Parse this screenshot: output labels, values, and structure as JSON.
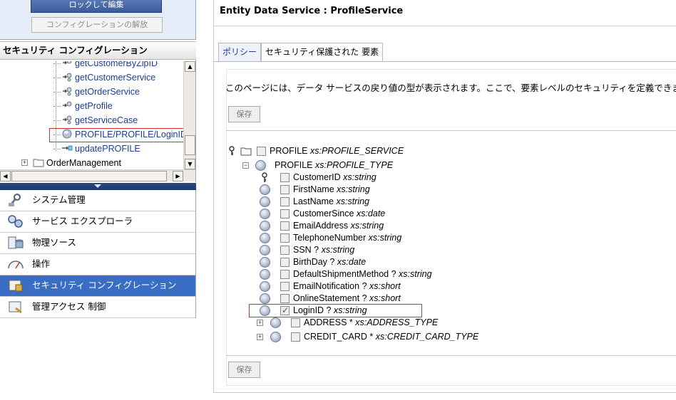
{
  "lock_panel": {
    "lock_edit": "ロックして編集",
    "release_config": "コンフィグレーションの解放"
  },
  "security_panel": {
    "title": "セキュリティ コンフィグレーション",
    "tree": [
      {
        "label": "getCustomerByZipID",
        "icon": "operation-icon"
      },
      {
        "label": "getCustomerService",
        "icon": "operation-icon"
      },
      {
        "label": "getOrderService",
        "icon": "operation-icon"
      },
      {
        "label": "getProfile",
        "icon": "operation-icon"
      },
      {
        "label": "getServiceCase",
        "icon": "operation-icon"
      },
      {
        "label": "PROFILE/PROFILE/LoginID",
        "icon": "element-icon",
        "highlighted": true
      },
      {
        "label": "updatePROFILE",
        "icon": "update-icon"
      },
      {
        "label": "OrderManagement",
        "icon": "folder-icon",
        "expandable": true
      }
    ]
  },
  "nav": [
    {
      "label": "システム管理",
      "icon": "system-admin-icon"
    },
    {
      "label": "サービス エクスプローラ",
      "icon": "service-explorer-icon"
    },
    {
      "label": "物理ソース",
      "icon": "physical-source-icon"
    },
    {
      "label": "操作",
      "icon": "operations-icon"
    },
    {
      "label": "セキュリティ コンフィグレーション",
      "icon": "security-config-icon",
      "active": true
    },
    {
      "label": "管理アクセス 制御",
      "icon": "admin-access-icon"
    }
  ],
  "main": {
    "title": "Entity Data Service : ProfileService",
    "tabs": [
      {
        "label": "ポリシー"
      },
      {
        "label": "セキュリティ保護された 要素"
      }
    ],
    "description": "このページには、データ サービスの戻り値の型が表示されます。ここで、要素レベルのセキュリティを定義できます。",
    "save_label": "保存",
    "root": {
      "name": "PROFILE",
      "type": "xs:PROFILE_SERVICE"
    },
    "profile": {
      "name": "PROFILE",
      "type": "xs:PROFILE_TYPE"
    },
    "fields": [
      {
        "name": "CustomerID",
        "type": "xs:string",
        "key": true
      },
      {
        "name": "FirstName",
        "type": "xs:string"
      },
      {
        "name": "LastName",
        "type": "xs:string"
      },
      {
        "name": "CustomerSince",
        "type": "xs:date"
      },
      {
        "name": "EmailAddress",
        "type": "xs:string"
      },
      {
        "name": "TelephoneNumber",
        "type": "xs:string"
      },
      {
        "name": "SSN ?",
        "type": "xs:string"
      },
      {
        "name": "BirthDay ?",
        "type": "xs:date"
      },
      {
        "name": "DefaultShipmentMethod ?",
        "type": "xs:string"
      },
      {
        "name": "EmailNotification ?",
        "type": "xs:short"
      },
      {
        "name": "OnlineStatement ?",
        "type": "xs:short"
      },
      {
        "name": "LoginID ?",
        "type": "xs:string",
        "checked": true
      }
    ],
    "complex": [
      {
        "name": "ADDRESS *",
        "type": "xs:ADDRESS_TYPE"
      },
      {
        "name": "CREDIT_CARD *",
        "type": "xs:CREDIT_CARD_TYPE"
      }
    ]
  }
}
